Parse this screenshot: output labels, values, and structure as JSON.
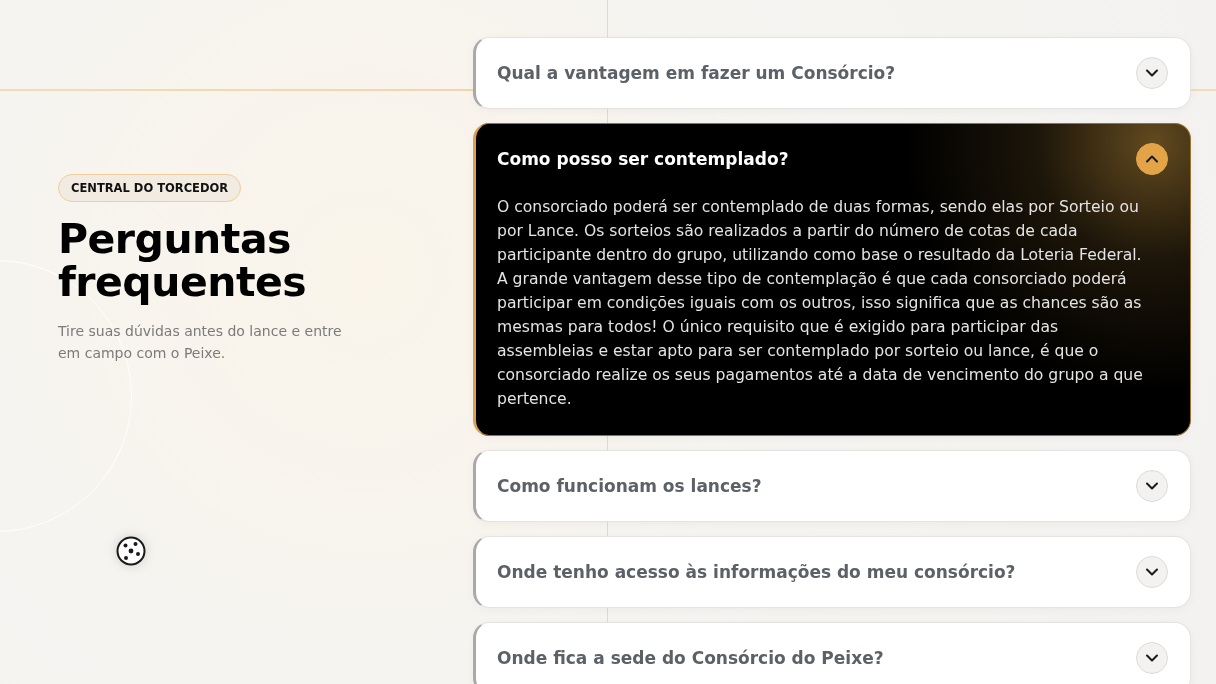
{
  "badge": "CENTRAL DO TORCEDOR",
  "title": "Perguntas frequentes",
  "subtitle": "Tire suas dúvidas antes do lance e entre em campo com o Peixe.",
  "faq": [
    {
      "question": "Qual a vantagem em fazer um Consórcio?",
      "expanded": false
    },
    {
      "question": "Como posso ser contemplado?",
      "expanded": true,
      "answer": "O consorciado poderá ser contemplado de duas formas, sendo elas por Sorteio ou por Lance. Os sorteios são realizados a partir do número de cotas de cada participante dentro do grupo, utilizando como base o resultado da Loteria Federal. A grande vantagem desse tipo de contemplação é que cada consorciado poderá participar em condições iguais com os outros, isso significa que as chances são as mesmas para todos! O único requisito que é exigido para participar das assembleias e estar apto para ser contemplado por sorteio ou lance, é que o consorciado realize os seus pagamentos até a data de vencimento do grupo a que pertence."
    },
    {
      "question": "Como funcionam os lances?",
      "expanded": false
    },
    {
      "question": "Onde tenho acesso às informações do meu consórcio?",
      "expanded": false
    },
    {
      "question": "Onde fica a sede do Consórcio do Peixe?",
      "expanded": false
    }
  ]
}
